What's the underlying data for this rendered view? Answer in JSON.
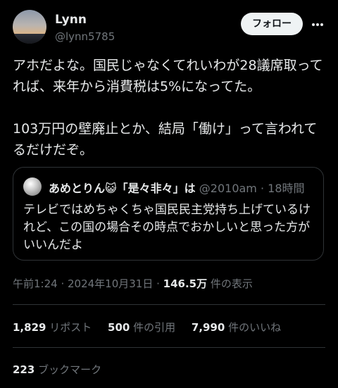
{
  "author": {
    "name": "Lynn",
    "handle": "@lynn5785"
  },
  "follow_label": "フォロー",
  "more_icon": "more-dots-icon",
  "tweet_text": "アホだよな。国民じゃなくてれいわが28議席取ってれば、来年から消費税は5%になってた。\n\n103万円の壁廃止とか、結局「働け」って言われてるだけだぞ。",
  "quote": {
    "name": "あめとりん😺「是々非々」は",
    "handle": "@2010am",
    "time": "· 18時間",
    "text": "テレビではめちゃくちゃ国民民主党持ち上げているけれど、この国の場合その時点でおかしいと思った方がいいんだよ"
  },
  "timestamp": {
    "time": "午前1:24 · 2024年10月31日 · ",
    "views_count": "146.5万",
    "views_label": " 件の表示"
  },
  "stats": {
    "reposts": {
      "count": "1,829",
      "label": " リポスト"
    },
    "quotes": {
      "count": "500",
      "label": " 件の引用"
    },
    "likes": {
      "count": "7,990",
      "label": " 件のいいね"
    }
  },
  "bookmarks": {
    "count": "223",
    "label": " ブックマーク"
  },
  "colors": {
    "background": "#000000",
    "text": "#e7e9ea",
    "muted": "#71767b",
    "border": "#2f3336",
    "button_bg": "#eff3f4"
  }
}
